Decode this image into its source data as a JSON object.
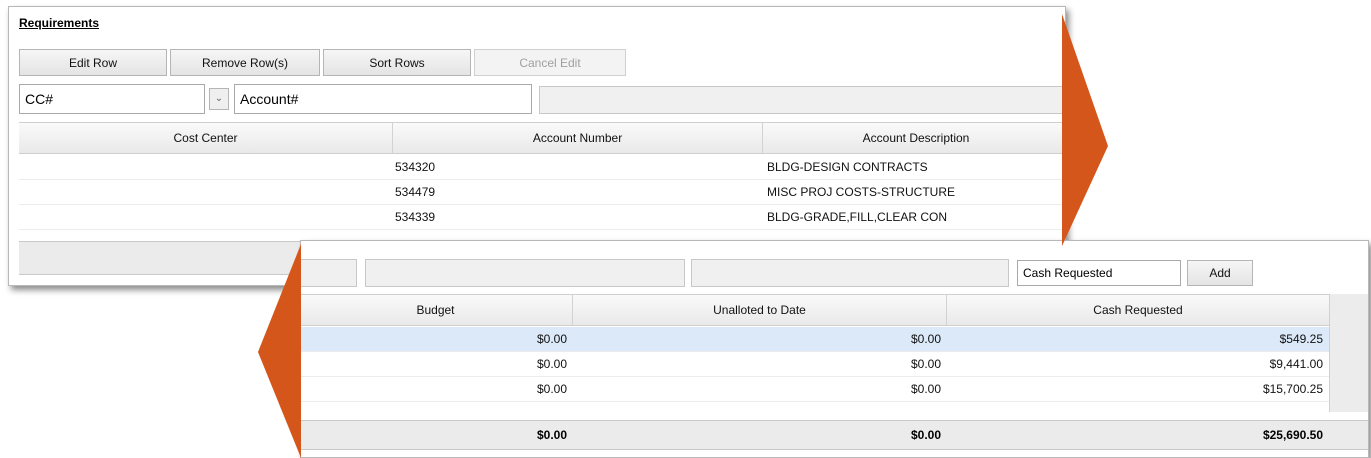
{
  "requirements": {
    "title": "Requirements",
    "toolbar": {
      "edit_row": "Edit Row",
      "remove_rows": "Remove Row(s)",
      "sort_rows": "Sort Rows",
      "cancel_edit": "Cancel Edit"
    },
    "filters": {
      "cc_value": "CC#",
      "account_value": "Account#"
    },
    "columns": [
      "Cost Center",
      "Account Number",
      "Account Description"
    ],
    "rows": [
      {
        "cost_center": "",
        "account_number": "534320",
        "account_description": "BLDG-DESIGN CONTRACTS"
      },
      {
        "cost_center": "",
        "account_number": "534479",
        "account_description": "MISC PROJ COSTS-STRUCTURE"
      },
      {
        "cost_center": "",
        "account_number": "534339",
        "account_description": "BLDG-GRADE,FILL,CLEAR CON"
      }
    ]
  },
  "detail": {
    "cash_requested_value": "Cash Requested",
    "add_label": "Add",
    "columns": [
      "Budget",
      "Unalloted to Date",
      "Cash Requested"
    ],
    "rows": [
      {
        "budget": "$0.00",
        "unalloted": "$0.00",
        "cash_requested": "$549.25"
      },
      {
        "budget": "$0.00",
        "unalloted": "$0.00",
        "cash_requested": "$9,441.00"
      },
      {
        "budget": "$0.00",
        "unalloted": "$0.00",
        "cash_requested": "$15,700.25"
      }
    ],
    "totals": {
      "budget": "$0.00",
      "unalloted": "$0.00",
      "cash_requested": "$25,690.50"
    }
  },
  "colors": {
    "arrow": "#d4561a",
    "selected_row": "#dbe9f9"
  }
}
